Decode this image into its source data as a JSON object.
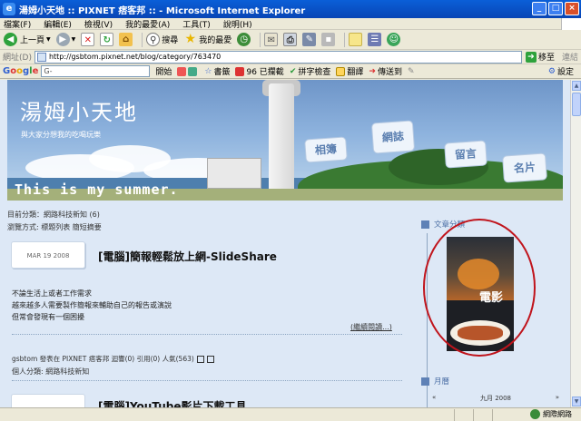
{
  "window": {
    "title": "湯姆小天地 :: PIXNET 痞客邦 :: - Microsoft Internet Explorer",
    "controls": [
      "_",
      "□",
      "×"
    ]
  },
  "menu": [
    "檔案(F)",
    "編輯(E)",
    "檢視(V)",
    "我的最愛(A)",
    "工具(T)",
    "說明(H)"
  ],
  "toolbar": {
    "back_label": "上一頁",
    "search_label": "搜尋",
    "favorites_label": "我的最愛"
  },
  "address": {
    "label": "網址(D)",
    "url": "http://gsbtom.pixnet.net/blog/category/763470",
    "go_label": "移至",
    "links_label": "連結"
  },
  "google_bar": {
    "logo": "Google",
    "search_value": "G-",
    "start_label": "開始",
    "bookmarks_label": "書籤",
    "blocked_label": "96 已攔截",
    "spellcheck_label": "拼字檢查",
    "translate_label": "翻譯",
    "sendto_label": "傳送到",
    "settings_label": "設定"
  },
  "banner": {
    "title": "湯姆小天地",
    "subtitle": "與大家分想我的吃喝玩樂",
    "slogan": "This is my summer.",
    "nav": [
      "相簿",
      "網誌",
      "留言",
      "名片"
    ]
  },
  "content": {
    "category_line": "目前分類：網路科技新知 (6)",
    "view_line": "瀏覽方式: 標題列表 簡短摘要",
    "post_date": "MAR 19 2008",
    "post_title": "[電腦]簡報輕鬆放上網-SlideShare",
    "post_body": [
      "不論生活上或者工作需求",
      "越來越多人需要製作簡報來輔助自己的報告或演說",
      "但常會發現有一個困擾"
    ],
    "read_more": "(繼續閱讀...)",
    "meta": "gsbtom 發表在 PIXNET 痞客邦 迴響(0) 引用(0) 人氣(563)",
    "personal_category": "個人分類: 網路科技新知",
    "next_post_title": "[電腦]YouTube影片下載工具"
  },
  "sidebar": {
    "category_heading": "文章分類",
    "poster_word": "電影",
    "calendar_heading": "月曆",
    "calendar_month": "九月 2008",
    "calendar_prev": "«",
    "calendar_next": "»"
  },
  "status": {
    "zone": "網際網路"
  }
}
